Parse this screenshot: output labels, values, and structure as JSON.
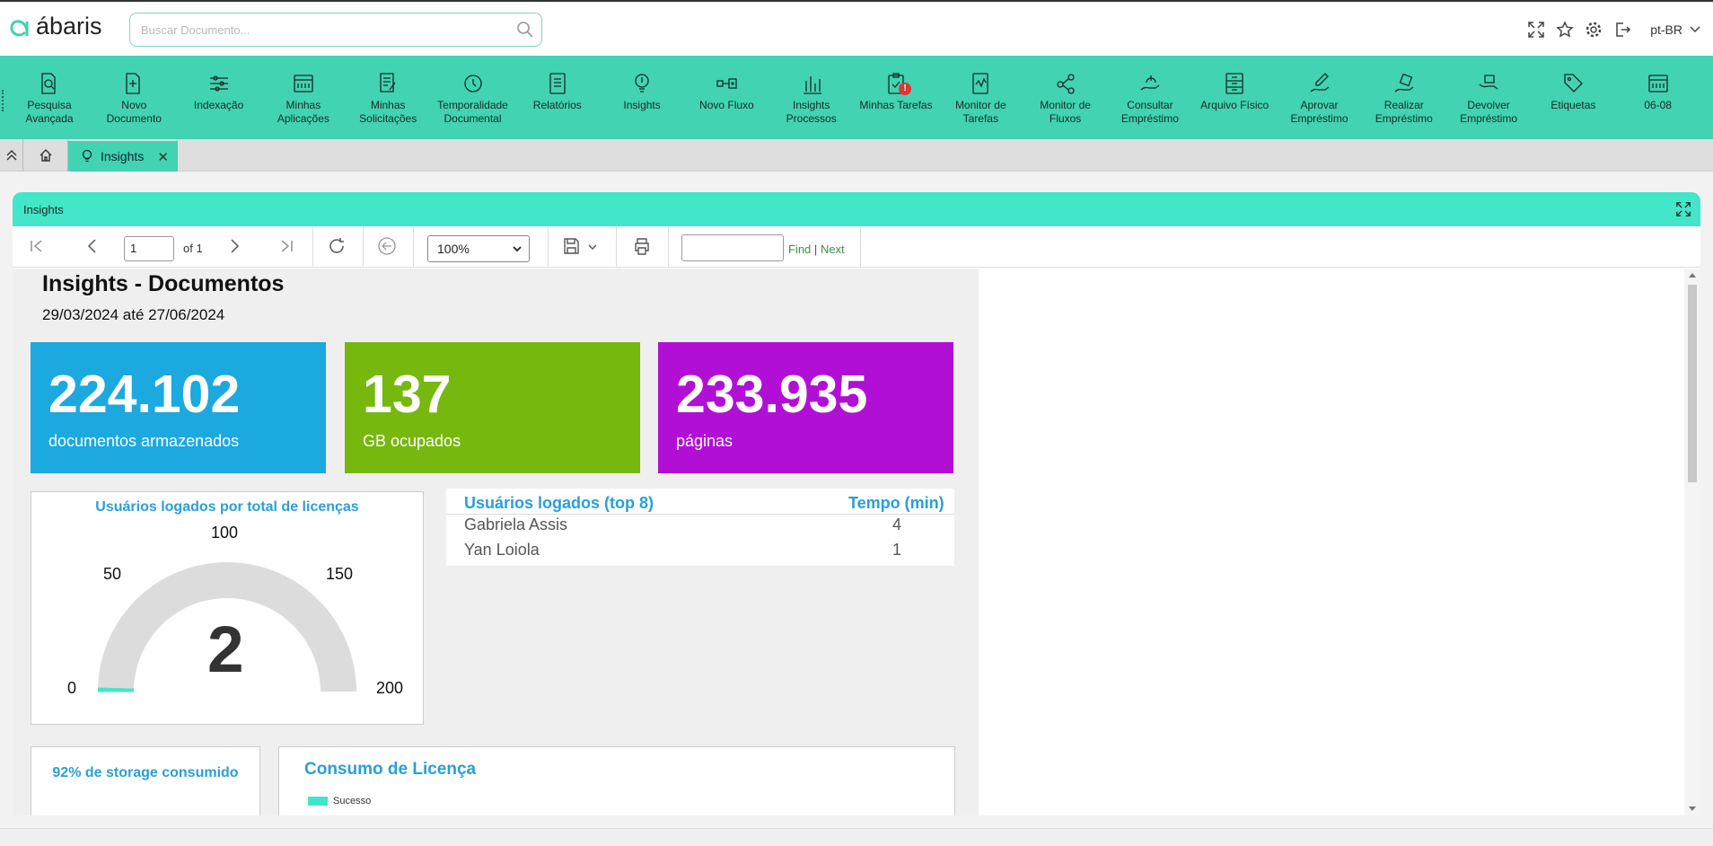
{
  "header": {
    "logo_text": "ábaris",
    "search_placeholder": "Buscar Documento...",
    "language": "pt-BR"
  },
  "toolbar": {
    "items": [
      {
        "line1": "Pesquisa",
        "line2": "Avançada",
        "icon": "search-doc-icon"
      },
      {
        "line1": "Novo",
        "line2": "Documento",
        "icon": "new-doc-icon"
      },
      {
        "line1": "Indexação",
        "line2": "",
        "icon": "sliders-icon"
      },
      {
        "line1": "Minhas",
        "line2": "Aplicações",
        "icon": "apps-icon"
      },
      {
        "line1": "Minhas",
        "line2": "Solicitações",
        "icon": "requests-icon"
      },
      {
        "line1": "Temporalidade",
        "line2": "Documental",
        "icon": "clock-icon"
      },
      {
        "line1": "Relatórios",
        "line2": "",
        "icon": "report-icon"
      },
      {
        "line1": "Insights",
        "line2": "",
        "icon": "lightbulb-icon"
      },
      {
        "line1": "Novo Fluxo",
        "line2": "",
        "icon": "flow-icon"
      },
      {
        "line1": "Insights",
        "line2": "Processos",
        "icon": "bar-chart-icon"
      },
      {
        "line1": "Minhas Tarefas",
        "line2": "",
        "icon": "tasks-icon",
        "badge": "!"
      },
      {
        "line1": "Monitor de",
        "line2": "Tarefas",
        "icon": "monitor-tasks-icon"
      },
      {
        "line1": "Monitor de",
        "line2": "Fluxos",
        "icon": "monitor-flows-icon"
      },
      {
        "line1": "Consultar",
        "line2": "Empréstimo",
        "icon": "loan-search-icon"
      },
      {
        "line1": "Arquivo Físico",
        "line2": "",
        "icon": "archive-icon"
      },
      {
        "line1": "Aprovar",
        "line2": "Empréstimo",
        "icon": "loan-approve-icon"
      },
      {
        "line1": "Realizar",
        "line2": "Empréstimo",
        "icon": "loan-make-icon"
      },
      {
        "line1": "Devolver",
        "line2": "Empréstimo",
        "icon": "loan-return-icon"
      },
      {
        "line1": "Etiquetas",
        "line2": "",
        "icon": "tag-icon"
      },
      {
        "line1": "06-08",
        "line2": "",
        "icon": "calendar-icon"
      }
    ]
  },
  "tabs": {
    "active_label": "Insights",
    "close_symbol": "✕"
  },
  "panel": {
    "title": "Insights"
  },
  "viewer": {
    "page_value": "1",
    "page_of": "of 1",
    "zoom": "100%",
    "find_label": "Find",
    "find_sep": "|",
    "next_label": "Next"
  },
  "report": {
    "title": "Insights - Documentos",
    "date_range": "29/03/2024 até 27/06/2024",
    "kpis": [
      {
        "value": "224.102",
        "label": "documentos armazenados",
        "color": "#1ba9df"
      },
      {
        "value": "137",
        "label": "GB ocupados",
        "color": "#76b80e"
      },
      {
        "value": "233.935",
        "label": "páginas",
        "color": "#b10fd6"
      }
    ],
    "gauge": {
      "title": "Usuários logados por total de licenças",
      "min_label": "0",
      "l50": "50",
      "l100": "100",
      "l150": "150",
      "max_label": "200",
      "value_label": "2",
      "value": 2,
      "max": 200
    },
    "users_table": {
      "col_user": "Usuários logados (top 8)",
      "col_time": "Tempo (min)",
      "rows": [
        {
          "name": "Gabriela Assis",
          "time": "4"
        },
        {
          "name": "Yan Loiola",
          "time": "1"
        }
      ]
    },
    "storage_title": "92% de storage consumido",
    "license": {
      "title": "Consumo de Licença",
      "legend": "Sucesso"
    }
  },
  "colors": {
    "accent": "#41d3b2",
    "panel_head": "#43e6c9",
    "link": "#2a9fd6"
  }
}
